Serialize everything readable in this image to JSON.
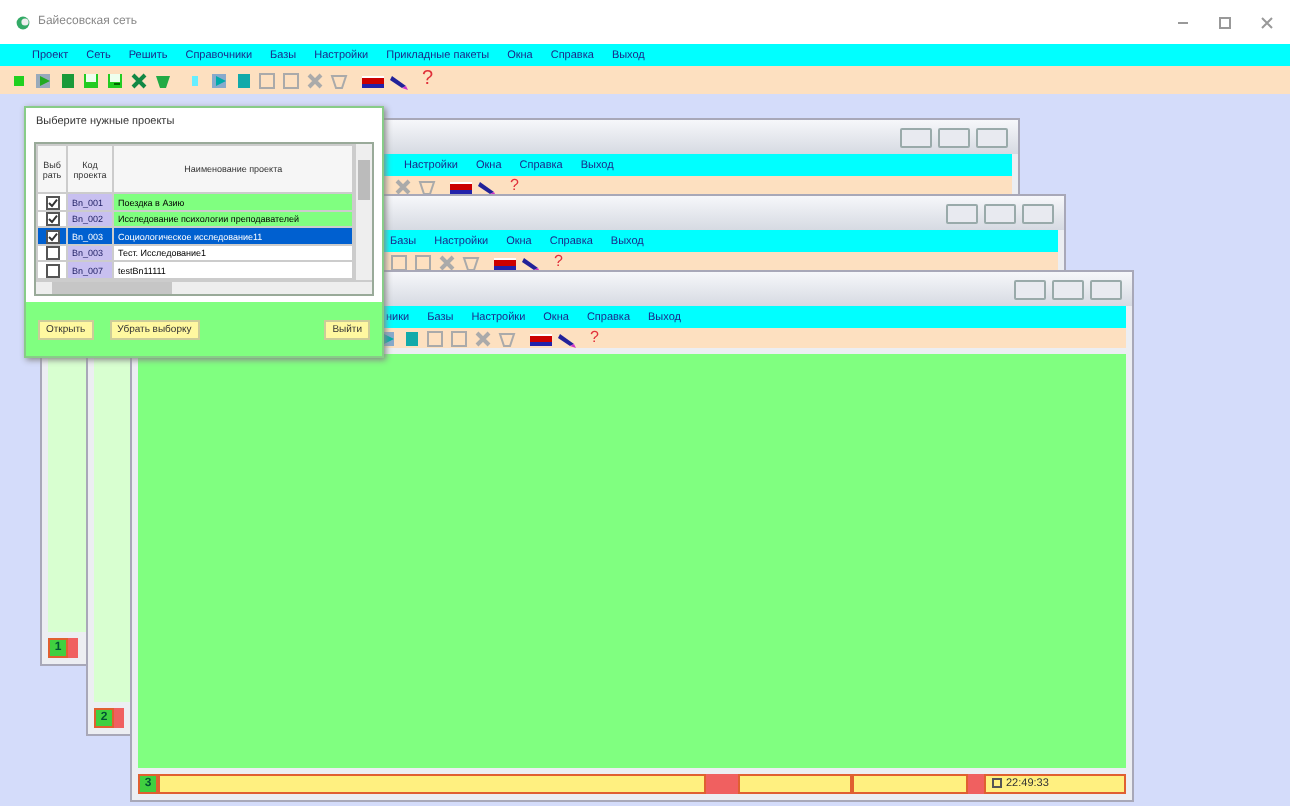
{
  "window": {
    "title": "Байесовская сеть"
  },
  "menu": [
    "Проект",
    "Сеть",
    "Решить",
    "Справочники",
    "Базы",
    "Настройки",
    "Прикладные пакеты",
    "Окна",
    "Справка",
    "Выход"
  ],
  "toolbar": {
    "help": "?"
  },
  "child_windows": [
    {
      "number": "1",
      "menu": [
        "Настройки",
        "Окна",
        "Справка",
        "Выход"
      ],
      "help": "?"
    },
    {
      "number": "2",
      "menu": [
        "Базы",
        "Настройки",
        "Окна",
        "Справка",
        "Выход"
      ],
      "help": "?"
    },
    {
      "number": "3",
      "menu": [
        "ники",
        "Базы",
        "Настройки",
        "Окна",
        "Справка",
        "Выход"
      ],
      "help": "?",
      "time": "22:49:33"
    }
  ],
  "dialog": {
    "title": "Выберите нужные проекты",
    "columns": [
      "Выб рать",
      "Код проекта",
      "Наименование проекта"
    ],
    "rows": [
      {
        "checked": true,
        "selected": false,
        "code": "Bn_001",
        "name": "Поездка в Азию"
      },
      {
        "checked": true,
        "selected": false,
        "code": "Bn_002",
        "name": "Исследование психологии преподавателей"
      },
      {
        "checked": true,
        "selected": true,
        "code": "Bn_003",
        "name": "Социологическое исследование11"
      },
      {
        "checked": false,
        "selected": false,
        "code": "Bn_003",
        "name": "Тест. Исследование1"
      },
      {
        "checked": false,
        "selected": false,
        "code": "Bn_007",
        "name": "testBn11111"
      }
    ],
    "buttons": [
      "Открыть",
      "Убрать выборку",
      "Выйти"
    ]
  }
}
